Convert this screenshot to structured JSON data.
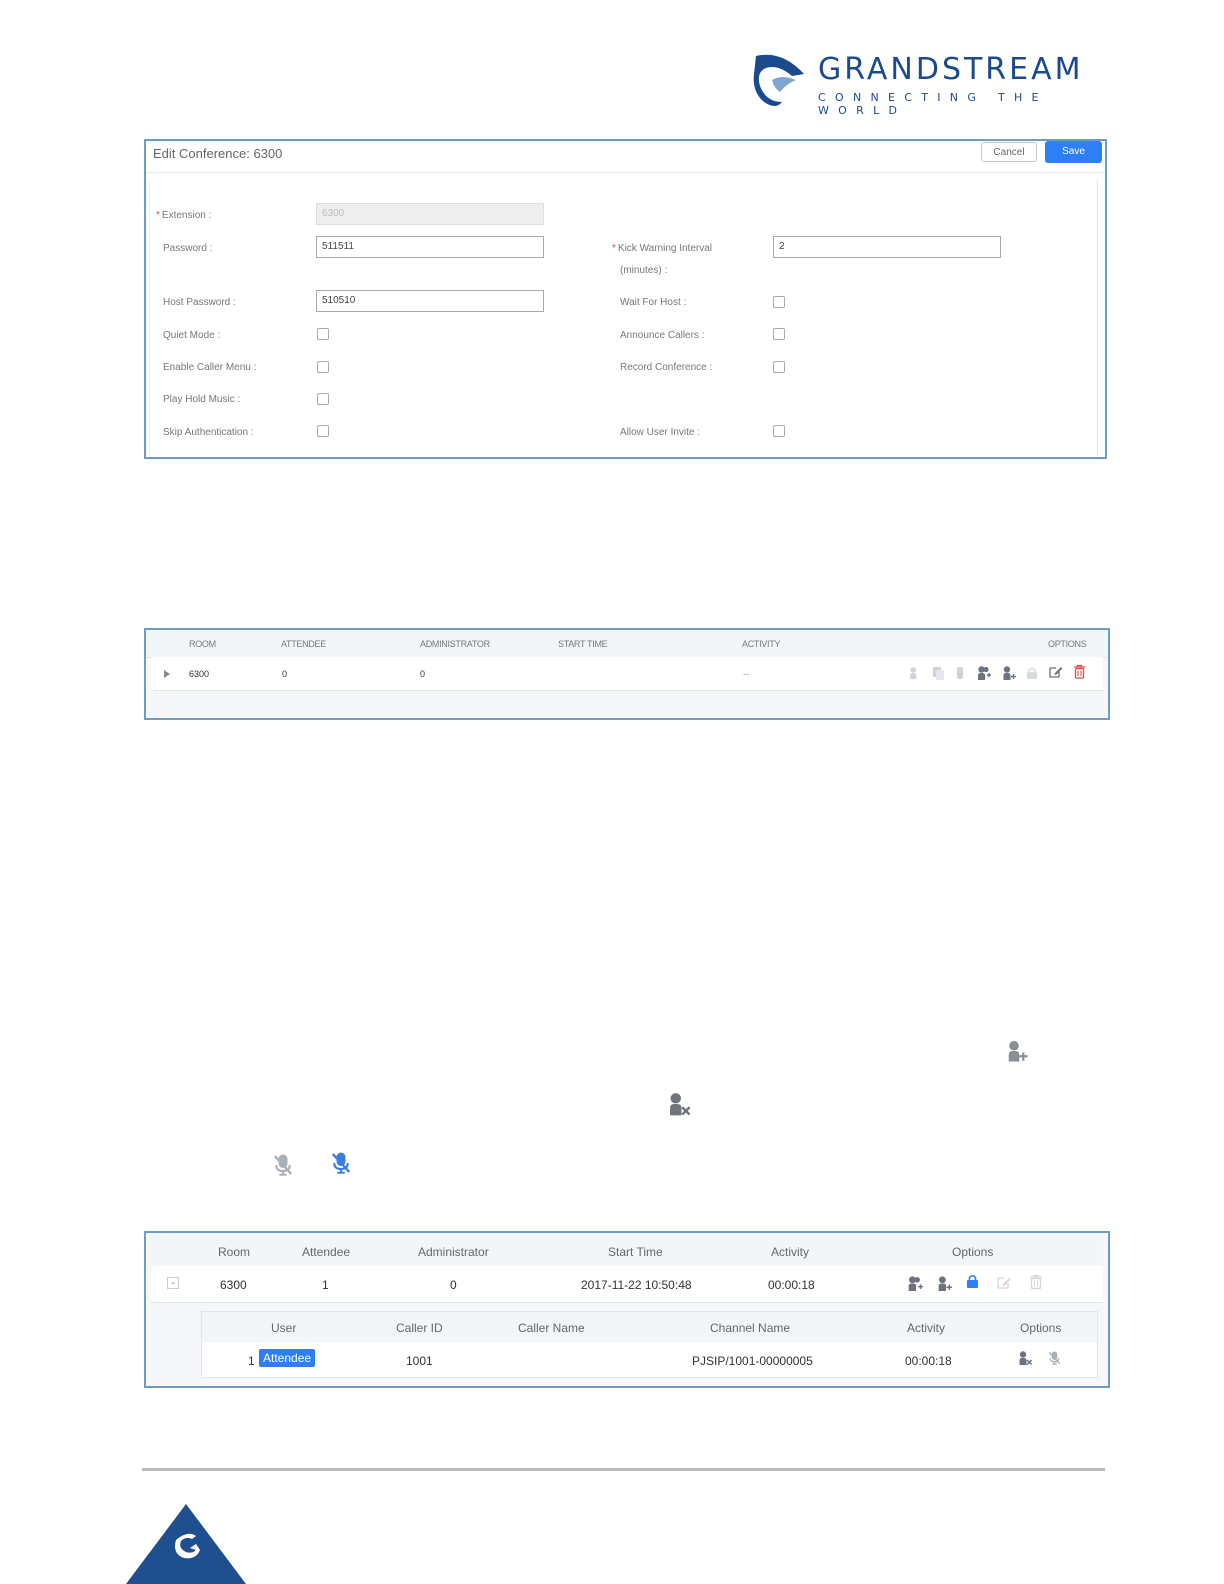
{
  "logo": {
    "wordmark": "GRANDSTREAM",
    "tagline": "CONNECTING THE WORLD"
  },
  "edit_panel": {
    "title": "Edit Conference: 6300",
    "cancel_label": "Cancel",
    "save_label": "Save",
    "extension_label": "Extension :",
    "extension_value": "6300",
    "password_label": "Password :",
    "password_value": "511511",
    "kick_label": "Kick Warning Interval",
    "kick_label2": "(minutes) :",
    "kick_value": "2",
    "host_password_label": "Host Password :",
    "host_password_value": "510510",
    "wait_for_host_label": "Wait For Host :",
    "quiet_mode_label": "Quiet Mode :",
    "announce_callers_label": "Announce Callers :",
    "enable_caller_menu_label": "Enable Caller Menu :",
    "record_conference_label": "Record Conference :",
    "play_hold_music_label": "Play Hold Music :",
    "skip_auth_label": "Skip Authentication :",
    "allow_user_invite_label": "Allow User Invite :"
  },
  "rooms_panel": {
    "headers": [
      "ROOM",
      "ATTENDEE",
      "ADMINISTRATOR",
      "START TIME",
      "ACTIVITY",
      "OPTIONS"
    ],
    "row": {
      "room": "6300",
      "attendee": "0",
      "administrator": "0",
      "start_time": "",
      "activity": "--"
    }
  },
  "active_panel": {
    "headers": [
      "Room",
      "Attendee",
      "Administrator",
      "Start Time",
      "Activity",
      "Options"
    ],
    "row": {
      "expander": "-",
      "room": "6300",
      "attendee": "1",
      "administrator": "0",
      "start_time": "2017-11-22 10:50:48",
      "activity": "00:00:18"
    },
    "sub_headers": [
      "User",
      "Caller ID",
      "Caller Name",
      "Channel Name",
      "Activity",
      "Options"
    ],
    "sub_row": {
      "index": "1",
      "user_badge": "Attendee",
      "caller_id": "1001",
      "caller_name": "",
      "channel_name": "PJSIP/1001-00000005",
      "activity": "00:00:18"
    }
  },
  "colors": {
    "accent": "#2e7ef6",
    "border": "#6e9cc6",
    "brand": "#1b4b8c",
    "delete": "#e24a4a"
  }
}
